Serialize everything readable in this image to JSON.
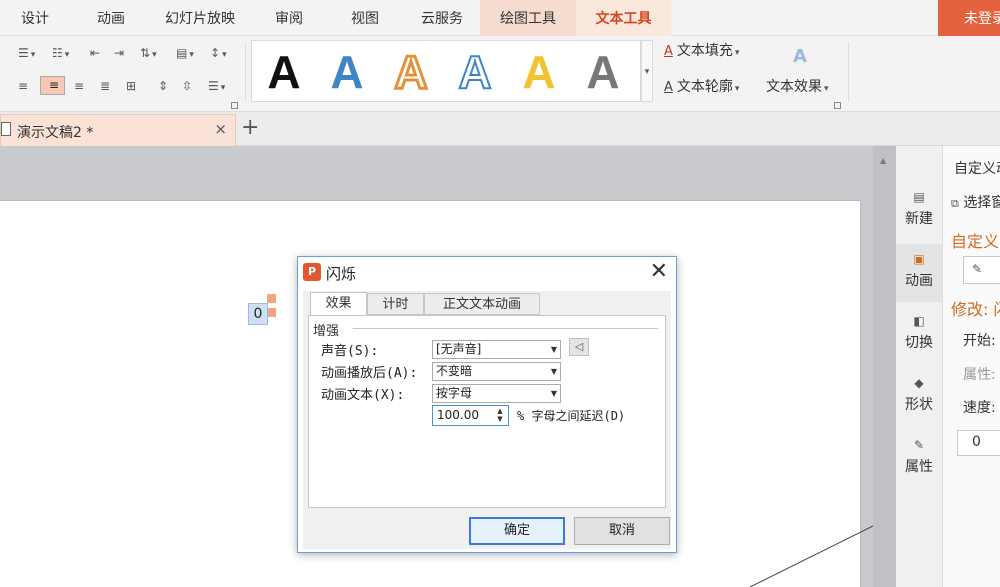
{
  "menu": {
    "tabs": [
      "设计",
      "动画",
      "幻灯片放映",
      "审阅",
      "视图",
      "云服务",
      "绘图工具",
      "文本工具"
    ],
    "login": "未登录"
  },
  "ribbon": {
    "gallery_glyph": "A",
    "text_fill": "文本填充",
    "text_outline": "文本轮廓",
    "text_effect": "文本效果",
    "fill_icon": "A",
    "outline_icon": "A",
    "effect_icon": "A"
  },
  "doc": {
    "tab_name": "演示文稿2 *",
    "close": "×",
    "add": "+"
  },
  "slide": {
    "marker_text": "0"
  },
  "right_panel": {
    "items": [
      "新建",
      "动画",
      "切换",
      "形状",
      "属性"
    ]
  },
  "task_pane": {
    "title": "自定义动",
    "select_label": "选择窗",
    "custom_heading": "自定义",
    "modify_label": "修改: 闪",
    "start_label": "开始:",
    "property_label": "属性:",
    "speed_label": "速度:",
    "list_value": "0"
  },
  "dialog": {
    "title": "闪烁",
    "close": "✕",
    "tabs": [
      "效果",
      "计时",
      "正文文本动画"
    ],
    "group_title": "增强",
    "sound_label": "声音(S):",
    "sound_value": "[无声音]",
    "after_label": "动画播放后(A):",
    "after_value": "不变暗",
    "text_label": "动画文本(X):",
    "text_value": "按字母",
    "delay_value": "100.00",
    "delay_unit": "%",
    "delay_label": "字母之间延迟(D)",
    "ok": "确定",
    "cancel": "取消"
  },
  "colors": {
    "accent": "#d24726",
    "login_bg": "#e4623d",
    "wordart": [
      "#111111",
      "#3d85c6",
      "#e69138",
      "#ffffff",
      "#f1c232",
      "#666666"
    ]
  }
}
